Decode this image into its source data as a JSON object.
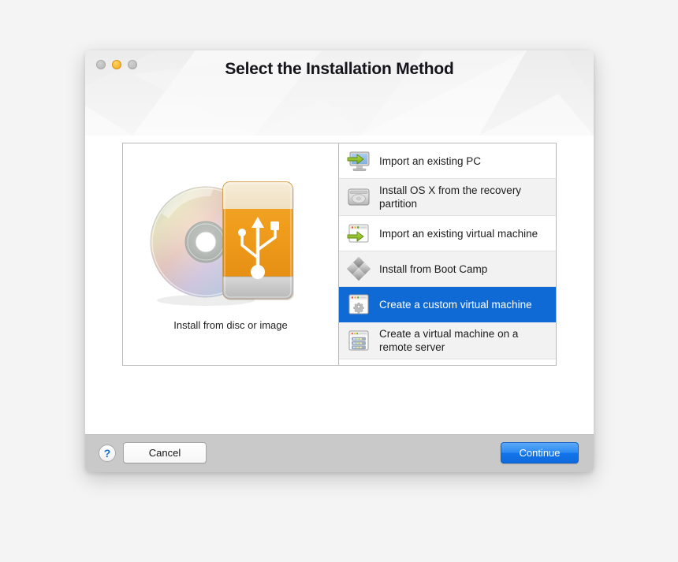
{
  "window": {
    "title": "Select the Installation Method",
    "traffic_lights": [
      {
        "name": "close",
        "color": "#b4b4b4",
        "enabled": false
      },
      {
        "name": "minimize",
        "color": "#f2a81b",
        "enabled": true
      },
      {
        "name": "zoom",
        "color": "#b4b4b4",
        "enabled": false
      }
    ]
  },
  "preview": {
    "label": "Install from disc or image",
    "icon": "disc-and-usb-drive-icon"
  },
  "methods": [
    {
      "label": "Import an existing PC",
      "icon": "monitor-import-icon",
      "selected": false,
      "alt": false
    },
    {
      "label": "Install OS X from the recovery partition",
      "icon": "hard-disk-icon",
      "selected": false,
      "alt": true
    },
    {
      "label": "Import an existing virtual machine",
      "icon": "window-green-arrow-icon",
      "selected": false,
      "alt": false
    },
    {
      "label": "Install from Boot Camp",
      "icon": "boot-camp-diamond-icon",
      "selected": false,
      "alt": true
    },
    {
      "label": "Create a custom virtual machine",
      "icon": "window-gear-icon",
      "selected": true,
      "alt": false
    },
    {
      "label": "Create a virtual machine on a remote server",
      "icon": "window-server-rack-icon",
      "selected": false,
      "alt": true
    }
  ],
  "footer": {
    "help_label": "?",
    "cancel_label": "Cancel",
    "continue_label": "Continue"
  },
  "colors": {
    "selection_blue": "#0f6ad6",
    "continue_blue": "#1274e9",
    "footer_gray": "#c9c9c9",
    "page_background": "#f4f4f4",
    "help_glyph_blue": "#1a6fd4"
  }
}
